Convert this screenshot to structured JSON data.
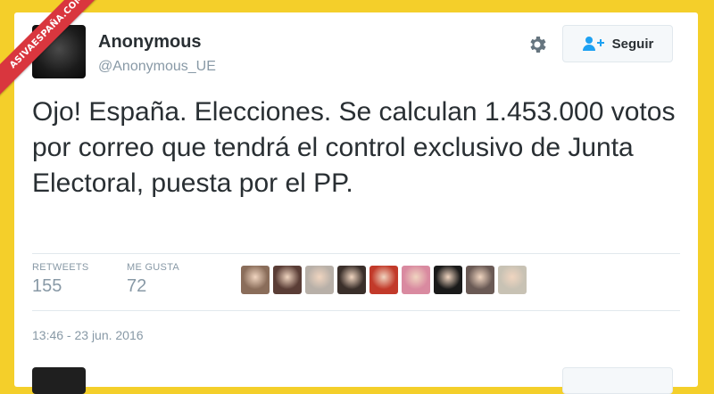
{
  "watermark": {
    "text": "ASIVAESPAÑA.COM",
    "color": "#d9363e"
  },
  "tweet": {
    "author_name": "Anonymous",
    "author_handle": "@Anonymous_UE",
    "follow_label": "Seguir",
    "text": "Ojo! España. Elecciones. Se calculan 1.453.000 votos por correo que tendrá el control exclusivo de Junta Electoral, puesta por el PP.",
    "retweets_label": "RETWEETS",
    "retweets_count": "155",
    "likes_label": "ME GUSTA",
    "likes_count": "72",
    "timestamp": "13:46 - 23 jun. 2016"
  },
  "icons": {
    "settings": "gear-icon",
    "follow": "person-add-icon"
  },
  "colors": {
    "background": "#f4cf2a",
    "card": "#ffffff",
    "text": "#292f33",
    "muted": "#8899a6",
    "follow_icon": "#1da1f2"
  },
  "likers": [
    {
      "name": "liker-avatar-1",
      "color": "#8a6d5a"
    },
    {
      "name": "liker-avatar-2",
      "color": "#5a3d36"
    },
    {
      "name": "liker-avatar-3",
      "color": "#b8b0a8"
    },
    {
      "name": "liker-avatar-4",
      "color": "#3a2f2a"
    },
    {
      "name": "liker-avatar-5",
      "color": "#c23a2a"
    },
    {
      "name": "liker-avatar-6",
      "color": "#d98aa0"
    },
    {
      "name": "liker-avatar-7",
      "color": "#1a1a1a"
    },
    {
      "name": "liker-avatar-8",
      "color": "#6a5a55"
    },
    {
      "name": "liker-avatar-9",
      "color": "#c8c2b4"
    }
  ]
}
